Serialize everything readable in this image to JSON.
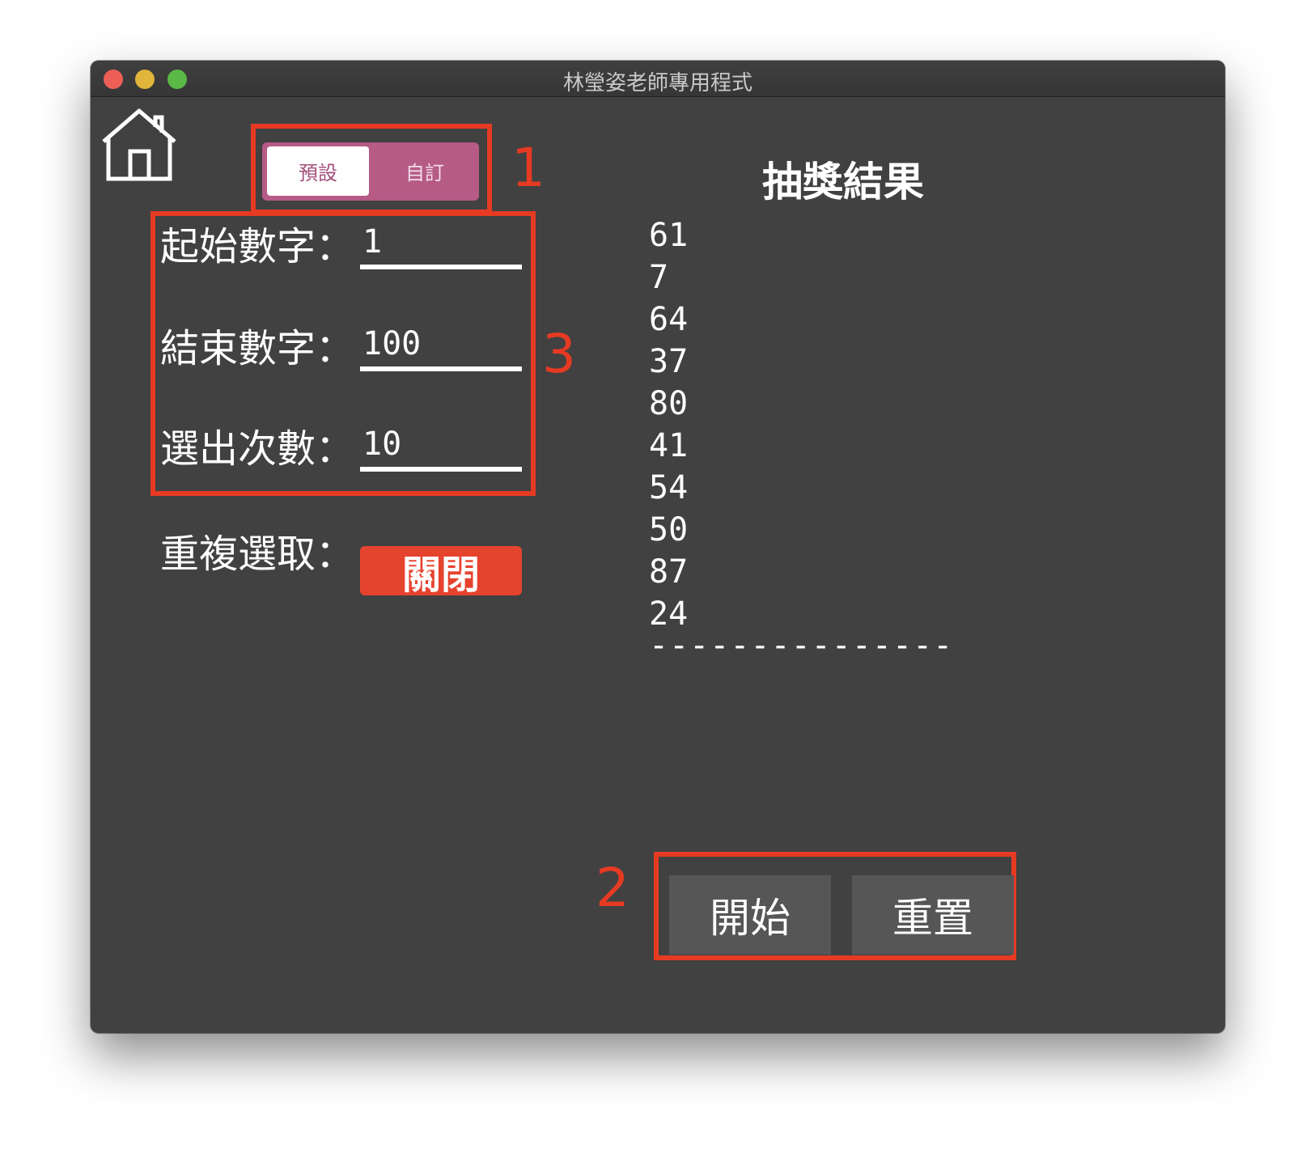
{
  "window": {
    "title": "林瑩姿老師專用程式"
  },
  "mode_toggle": {
    "selected": "預設",
    "options": [
      "預設",
      "自訂"
    ]
  },
  "annotations": [
    "1",
    "2",
    "3"
  ],
  "form": {
    "start_label": "起始數字：",
    "start_value": "1",
    "end_label": "結束數字：",
    "end_value": "100",
    "count_label": "選出次數：",
    "count_value": "10",
    "repeat_label": "重複選取：",
    "repeat_value": "關閉"
  },
  "results": {
    "title": "抽獎結果",
    "numbers": [
      "61",
      "7",
      "64",
      "37",
      "80",
      "41",
      "54",
      "50",
      "87",
      "24"
    ],
    "separator": "---------------"
  },
  "actions": {
    "start_label": "開始",
    "reset_label": "重置"
  },
  "colors": {
    "window_bg": "#414141",
    "toggle_accent": "#b65a86",
    "annotation_red": "#e63a23",
    "repeat_off": "#e6432f",
    "button_bg": "#565656"
  },
  "icons": {
    "home": "home-icon"
  }
}
